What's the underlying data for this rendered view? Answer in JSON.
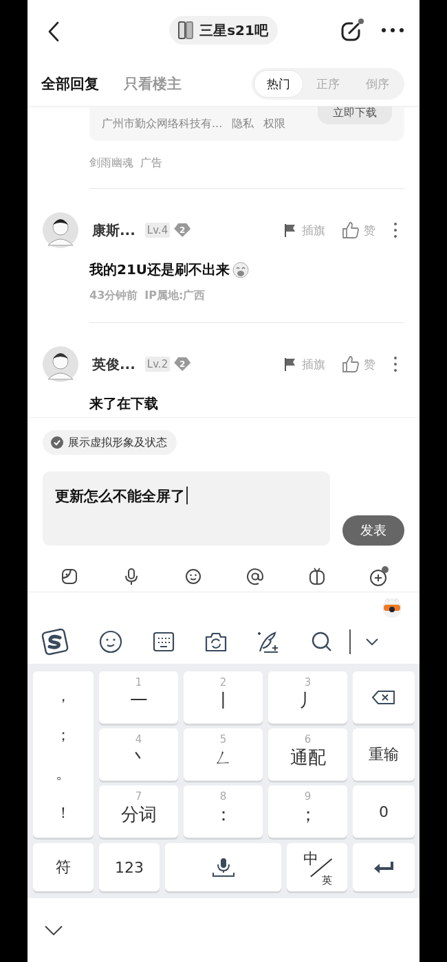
{
  "header": {
    "title": "三星s21吧"
  },
  "filter_tabs": [
    {
      "label": "全部回复",
      "selected": true
    },
    {
      "label": "只看楼主",
      "selected": false
    }
  ],
  "sort_options": [
    {
      "label": "热门",
      "selected": true
    },
    {
      "label": "正序",
      "selected": false
    },
    {
      "label": "倒序",
      "selected": false
    }
  ],
  "ad": {
    "company": "广州市勤众网络科技有...",
    "links": [
      "隐私",
      "权限"
    ],
    "button": "立即下载",
    "source": "剑雨幽魂",
    "tag": "广告"
  },
  "comments": [
    {
      "name": "康斯...",
      "level": "Lv.4",
      "badge": "2",
      "flag": "插旗",
      "like": "赞",
      "text": "我的21U还是刷不出来",
      "time": "43分钟前",
      "location": "IP属地:广西"
    },
    {
      "name": "英俊...",
      "level": "Lv.2",
      "badge": "2",
      "flag": "插旗",
      "like": "赞",
      "text": "来了在下载"
    }
  ],
  "reply": {
    "avatar_toggle": {
      "label": "展示虚拟形象及状态",
      "checked": true
    },
    "value": "更新怎么不能全屏了",
    "send": "发表"
  },
  "keyboard": {
    "left_column": [
      "，",
      "；",
      "。",
      "！"
    ],
    "rows": [
      [
        {
          "kind": "stroke",
          "number": "1",
          "label": "一"
        },
        {
          "kind": "stroke",
          "number": "2",
          "label": "丨"
        },
        {
          "kind": "stroke",
          "number": "3",
          "label": "丿"
        },
        {
          "kind": "backspace"
        }
      ],
      [
        {
          "kind": "stroke",
          "number": "4",
          "label": "丶"
        },
        {
          "kind": "stroke",
          "number": "5",
          "label": "ㄥ"
        },
        {
          "kind": "stroke",
          "number": "6",
          "label": "通配"
        },
        {
          "kind": "text",
          "label": "重输"
        }
      ],
      [
        {
          "kind": "stroke",
          "number": "7",
          "label": "分词"
        },
        {
          "kind": "stroke",
          "number": "8",
          "label": "："
        },
        {
          "kind": "stroke",
          "number": "9",
          "label": "；"
        },
        {
          "kind": "text",
          "label": "0"
        }
      ]
    ],
    "bottom_row": [
      {
        "kind": "text",
        "label": "符"
      },
      {
        "kind": "text",
        "label": "123"
      },
      {
        "kind": "space"
      },
      {
        "kind": "lang",
        "primary": "中",
        "secondary": "英"
      },
      {
        "kind": "enter"
      }
    ]
  }
}
